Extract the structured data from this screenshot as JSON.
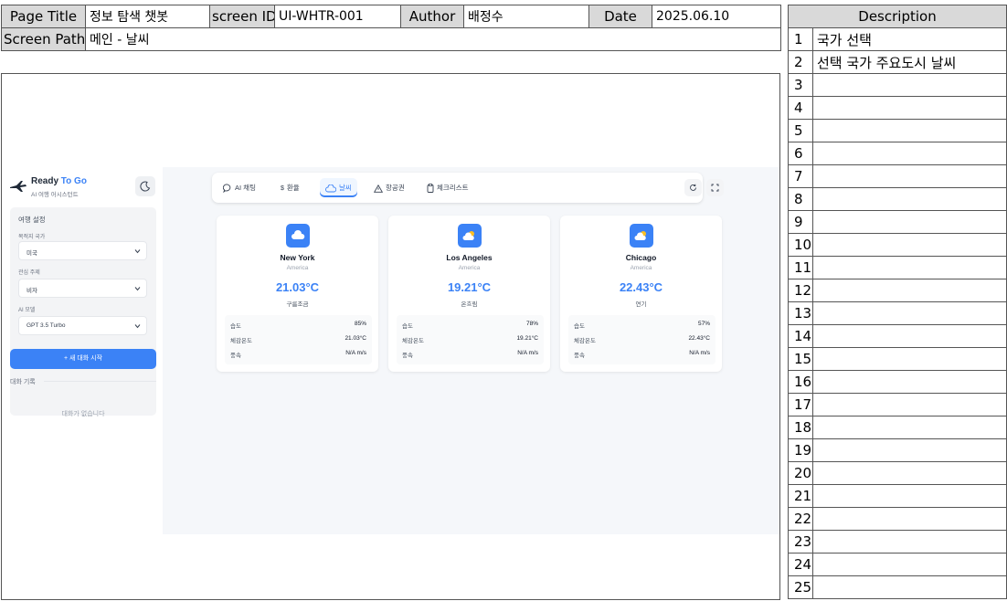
{
  "spec": {
    "page_title_label": "Page Title",
    "page_title": "정보 탐색 챗봇",
    "screen_id_label": "screen ID",
    "screen_id": "UI-WHTR-001",
    "author_label": "Author",
    "author": "배정수",
    "date_label": "Date",
    "date": "2025.06.10",
    "screen_path_label": "Screen Path",
    "screen_path": "메인 - 날씨"
  },
  "app": {
    "brand_ready": "Ready",
    "brand_togo": "To Go",
    "brand_subtitle": "AI 여행 어시스턴트",
    "settings_title": "여행 설정",
    "country_label": "목적지 국가",
    "country_value": "미국",
    "topic_label": "관심 주제",
    "topic_value": "비자",
    "model_label": "AI 모델",
    "model_value": "GPT 3.5 Turbo",
    "new_chat_label": "+ 새 대화 시작",
    "history_title": "대화 기록",
    "history_empty": "대화가 없습니다",
    "accent_color": "#3b82f6"
  },
  "tabs": [
    {
      "label": "AI 채팅",
      "icon": "chat-bubble-icon"
    },
    {
      "label": "환율",
      "icon": "dollar-icon"
    },
    {
      "label": "날씨",
      "icon": "cloud-icon",
      "active": true
    },
    {
      "label": "항공권",
      "icon": "warning-icon"
    },
    {
      "label": "체크리스트",
      "icon": "clipboard-icon"
    }
  ],
  "weather": {
    "humidity_label": "습도",
    "feels_like_label": "체감온도",
    "wind_label": "풍속",
    "cards": [
      {
        "city": "New York",
        "country": "America",
        "temp": "21.03°C",
        "condition": "구름조금",
        "humidity": "85%",
        "feels_like": "21.03°C",
        "wind": "N/A m/s",
        "icon": "cloud-icon"
      },
      {
        "city": "Los Angeles",
        "country": "America",
        "temp": "19.21°C",
        "condition": "온흐림",
        "humidity": "78%",
        "feels_like": "19.21°C",
        "wind": "N/A m/s",
        "icon": "partly-cloudy-icon"
      },
      {
        "city": "Chicago",
        "country": "America",
        "temp": "22.43°C",
        "condition": "연기",
        "humidity": "57%",
        "feels_like": "22.43°C",
        "wind": "N/A m/s",
        "icon": "partly-cloudy-icon"
      }
    ]
  },
  "description": {
    "header": "Description",
    "rows": [
      {
        "num": "1",
        "text": "국가 선택"
      },
      {
        "num": "2",
        "text": "선택 국가 주요도시 날씨"
      },
      {
        "num": "3",
        "text": ""
      },
      {
        "num": "4",
        "text": ""
      },
      {
        "num": "5",
        "text": ""
      },
      {
        "num": "6",
        "text": ""
      },
      {
        "num": "7",
        "text": ""
      },
      {
        "num": "8",
        "text": ""
      },
      {
        "num": "9",
        "text": ""
      },
      {
        "num": "10",
        "text": ""
      },
      {
        "num": "11",
        "text": ""
      },
      {
        "num": "12",
        "text": ""
      },
      {
        "num": "13",
        "text": ""
      },
      {
        "num": "14",
        "text": ""
      },
      {
        "num": "15",
        "text": ""
      },
      {
        "num": "16",
        "text": ""
      },
      {
        "num": "17",
        "text": ""
      },
      {
        "num": "18",
        "text": ""
      },
      {
        "num": "19",
        "text": ""
      },
      {
        "num": "20",
        "text": ""
      },
      {
        "num": "21",
        "text": ""
      },
      {
        "num": "22",
        "text": ""
      },
      {
        "num": "23",
        "text": ""
      },
      {
        "num": "24",
        "text": ""
      },
      {
        "num": "25",
        "text": ""
      }
    ]
  }
}
